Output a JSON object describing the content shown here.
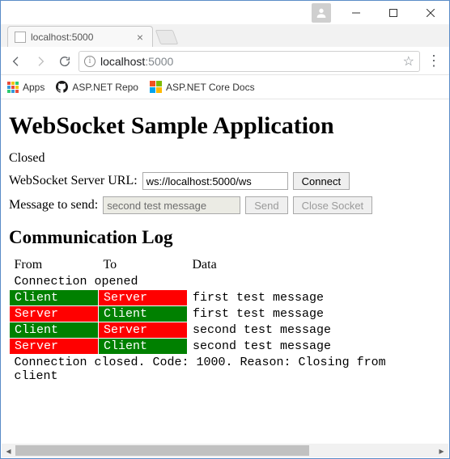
{
  "window": {
    "tab_title": "localhost:5000",
    "url_host": "localhost",
    "url_rest": ":5000"
  },
  "bookmarks": {
    "apps_label": "Apps",
    "item1_label": "ASP.NET Repo",
    "item2_label": "ASP.NET Core Docs"
  },
  "page": {
    "heading": "WebSocket Sample Application",
    "status": "Closed",
    "url_label": "WebSocket Server URL:",
    "url_value": "ws://localhost:5000/ws",
    "connect_btn": "Connect",
    "msg_label": "Message to send:",
    "msg_value": "second test message",
    "send_btn": "Send",
    "close_btn": "Close Socket",
    "log_heading": "Communication Log",
    "columns": {
      "from": "From",
      "to": "To",
      "data": "Data"
    },
    "labels": {
      "client": "Client",
      "server": "Server"
    },
    "log": {
      "opened": "Connection opened",
      "rows": [
        {
          "from": "client",
          "to": "server",
          "data": "first test message"
        },
        {
          "from": "server",
          "to": "client",
          "data": "first test message"
        },
        {
          "from": "client",
          "to": "server",
          "data": "second test message"
        },
        {
          "from": "server",
          "to": "client",
          "data": "second test message"
        }
      ],
      "closed": "Connection closed. Code: 1000. Reason: Closing from client"
    }
  }
}
